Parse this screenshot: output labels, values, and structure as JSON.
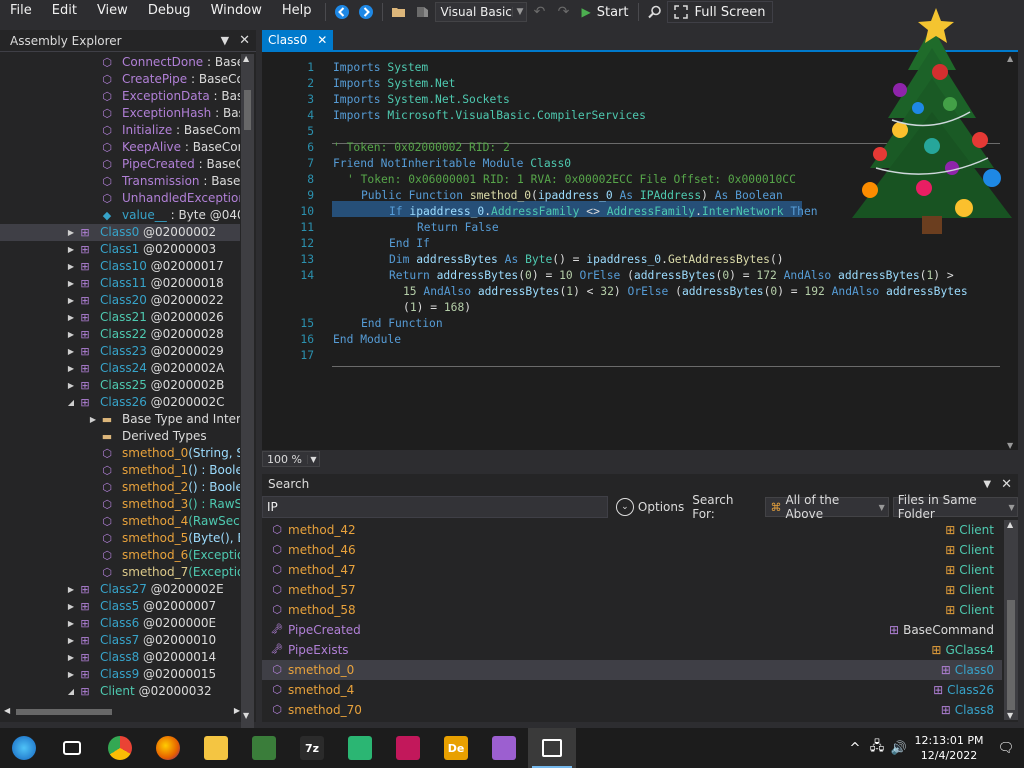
{
  "menu": [
    "File",
    "Edit",
    "View",
    "Debug",
    "Window",
    "Help"
  ],
  "toolbar": {
    "language": "Visual Basic",
    "start": "Start",
    "fullscreen": "Full Screen"
  },
  "explorer": {
    "title": "Assembly Explorer",
    "rows": [
      {
        "indent": 2,
        "expander": "",
        "icon": "method-icon",
        "name": "ConnectDone",
        "sig": " : BaseCo",
        "name_color": "purple",
        "sig_color": "gray"
      },
      {
        "indent": 2,
        "expander": "",
        "icon": "method-icon",
        "name": "CreatePipe",
        "sig": " : BaseCom",
        "name_color": "purple",
        "sig_color": "gray"
      },
      {
        "indent": 2,
        "expander": "",
        "icon": "method-icon",
        "name": "ExceptionData",
        "sig": " : BaseC",
        "name_color": "purple",
        "sig_color": "gray"
      },
      {
        "indent": 2,
        "expander": "",
        "icon": "method-icon",
        "name": "ExceptionHash",
        "sig": " : BaseC",
        "name_color": "purple",
        "sig_color": "gray"
      },
      {
        "indent": 2,
        "expander": "",
        "icon": "method-icon",
        "name": "Initialize",
        "sig": " : BaseComma",
        "name_color": "purple",
        "sig_color": "gray"
      },
      {
        "indent": 2,
        "expander": "",
        "icon": "method-icon",
        "name": "KeepAlive",
        "sig": " : BaseComr",
        "name_color": "purple",
        "sig_color": "gray"
      },
      {
        "indent": 2,
        "expander": "",
        "icon": "method-icon",
        "name": "PipeCreated",
        "sig": " : BaseCor",
        "name_color": "purple",
        "sig_color": "gray"
      },
      {
        "indent": 2,
        "expander": "",
        "icon": "method-icon",
        "name": "Transmission",
        "sig": " : BaseCo",
        "name_color": "purple",
        "sig_color": "gray"
      },
      {
        "indent": 2,
        "expander": "",
        "icon": "method-icon",
        "name": "UnhandledException",
        "sig": " :",
        "name_color": "purple",
        "sig_color": "gray"
      },
      {
        "indent": 2,
        "expander": "",
        "icon": "field-icon",
        "name": "value__",
        "sig": " : Byte @04000",
        "name_color": "cyan",
        "sig_color": "gray"
      },
      {
        "indent": 1,
        "expander": "▶",
        "icon": "class-icon",
        "name": "Class0",
        "sig": " @02000002",
        "name_color": "cyan",
        "sig_color": "gray",
        "selected": true
      },
      {
        "indent": 1,
        "expander": "▶",
        "icon": "class-icon",
        "name": "Class1",
        "sig": " @02000003",
        "name_color": "cyan",
        "sig_color": "gray"
      },
      {
        "indent": 1,
        "expander": "▶",
        "icon": "class-icon",
        "name": "Class10",
        "sig": " @02000017",
        "name_color": "cyan",
        "sig_color": "gray"
      },
      {
        "indent": 1,
        "expander": "▶",
        "icon": "class-icon",
        "name": "Class11",
        "sig": " @02000018",
        "name_color": "cyan",
        "sig_color": "gray"
      },
      {
        "indent": 1,
        "expander": "▶",
        "icon": "class-icon",
        "name": "Class20",
        "sig": " @02000022",
        "name_color": "cyan",
        "sig_color": "gray"
      },
      {
        "indent": 1,
        "expander": "▶",
        "icon": "class-icon",
        "name": "Class21",
        "sig": " @02000026",
        "name_color": "teal",
        "sig_color": "gray"
      },
      {
        "indent": 1,
        "expander": "▶",
        "icon": "class-icon",
        "name": "Class22",
        "sig": " @02000028",
        "name_color": "teal",
        "sig_color": "gray"
      },
      {
        "indent": 1,
        "expander": "▶",
        "icon": "class-icon",
        "name": "Class23",
        "sig": " @02000029",
        "name_color": "cyan",
        "sig_color": "gray"
      },
      {
        "indent": 1,
        "expander": "▶",
        "icon": "class-icon",
        "name": "Class24",
        "sig": " @0200002A",
        "name_color": "cyan",
        "sig_color": "gray"
      },
      {
        "indent": 1,
        "expander": "▶",
        "icon": "class-icon",
        "name": "Class25",
        "sig": " @0200002B",
        "name_color": "teal",
        "sig_color": "gray"
      },
      {
        "indent": 1,
        "expander": "◢",
        "icon": "class-icon",
        "name": "Class26",
        "sig": " @0200002C",
        "name_color": "cyan",
        "sig_color": "gray"
      },
      {
        "indent": 2,
        "expander": "▶",
        "icon": "folder-icon",
        "name": "Base Type and Interfac",
        "sig": "",
        "name_color": "gray",
        "sig_color": "gray"
      },
      {
        "indent": 2,
        "expander": "",
        "icon": "folder-icon",
        "name": "Derived Types",
        "sig": "",
        "name_color": "gray",
        "sig_color": "gray"
      },
      {
        "indent": 2,
        "expander": "",
        "icon": "method-icon",
        "name": "smethod_0",
        "sig": "(String, Stri",
        "name_color": "orange",
        "sig_color": "blue"
      },
      {
        "indent": 2,
        "expander": "",
        "icon": "method-icon",
        "name": "smethod_1",
        "sig": "() : Boolear",
        "name_color": "orange",
        "sig_color": "blue"
      },
      {
        "indent": 2,
        "expander": "",
        "icon": "method-icon",
        "name": "smethod_2",
        "sig": "() : Boolear",
        "name_color": "orange",
        "sig_color": "blue"
      },
      {
        "indent": 2,
        "expander": "",
        "icon": "method-icon",
        "name": "smethod_3",
        "sig": "() : RawSec",
        "name_color": "orange",
        "sig_color": "teal"
      },
      {
        "indent": 2,
        "expander": "",
        "icon": "method-icon",
        "name": "smethod_4",
        "sig": "(RawSecuri",
        "name_color": "orange",
        "sig_color": "teal"
      },
      {
        "indent": 2,
        "expander": "",
        "icon": "method-icon",
        "name": "smethod_5",
        "sig": "(Byte(), Byt",
        "name_color": "orange",
        "sig_color": "blue"
      },
      {
        "indent": 2,
        "expander": "",
        "icon": "method-icon",
        "name": "smethod_6",
        "sig": "(Exception)",
        "name_color": "orange",
        "sig_color": "teal"
      },
      {
        "indent": 2,
        "expander": "",
        "icon": "method-icon",
        "name": "smethod_7",
        "sig": "(Exception)",
        "name_color": "yellow",
        "sig_color": "teal"
      },
      {
        "indent": 1,
        "expander": "▶",
        "icon": "class-icon",
        "name": "Class27",
        "sig": " @0200002E",
        "name_color": "cyan",
        "sig_color": "gray"
      },
      {
        "indent": 1,
        "expander": "▶",
        "icon": "class-icon",
        "name": "Class5",
        "sig": " @02000007",
        "name_color": "cyan",
        "sig_color": "gray"
      },
      {
        "indent": 1,
        "expander": "▶",
        "icon": "class-icon",
        "name": "Class6",
        "sig": " @0200000E",
        "name_color": "cyan",
        "sig_color": "gray"
      },
      {
        "indent": 1,
        "expander": "▶",
        "icon": "class-icon",
        "name": "Class7",
        "sig": " @02000010",
        "name_color": "cyan",
        "sig_color": "gray"
      },
      {
        "indent": 1,
        "expander": "▶",
        "icon": "class-icon",
        "name": "Class8",
        "sig": " @02000014",
        "name_color": "cyan",
        "sig_color": "gray"
      },
      {
        "indent": 1,
        "expander": "▶",
        "icon": "class-icon",
        "name": "Class9",
        "sig": " @02000015",
        "name_color": "cyan",
        "sig_color": "gray"
      },
      {
        "indent": 1,
        "expander": "◢",
        "icon": "class-icon",
        "name": "Client",
        "sig": " @02000032",
        "name_color": "teal",
        "sig_color": "gray"
      }
    ]
  },
  "editor": {
    "tab": "Class0",
    "zoom": "100 %",
    "lines": [
      {
        "n": "1",
        "indent": 0,
        "tokens": [
          [
            "k",
            "Imports "
          ],
          [
            "t",
            "System"
          ]
        ]
      },
      {
        "n": "2",
        "indent": 0,
        "tokens": [
          [
            "k",
            "Imports "
          ],
          [
            "t",
            "System.Net"
          ]
        ]
      },
      {
        "n": "3",
        "indent": 0,
        "tokens": [
          [
            "k",
            "Imports "
          ],
          [
            "t",
            "System.Net.Sockets"
          ]
        ]
      },
      {
        "n": "4",
        "indent": 0,
        "tokens": [
          [
            "k",
            "Imports "
          ],
          [
            "t",
            "Microsoft.VisualBasic.CompilerServices"
          ]
        ]
      },
      {
        "n": "5",
        "indent": 0,
        "tokens": []
      },
      {
        "n": "6",
        "indent": 0,
        "tokens": [
          [
            "cm",
            "' Token: 0x02000002 RID: 2"
          ]
        ]
      },
      {
        "n": "7",
        "indent": 0,
        "tokens": [
          [
            "k",
            "Friend NotInheritable Module "
          ],
          [
            "t",
            "Class0"
          ]
        ]
      },
      {
        "n": "8",
        "indent": 2,
        "tokens": [
          [
            "cm",
            "' Token: 0x06000001 RID: 1 RVA: 0x00002ECC File Offset: 0x000010CC"
          ]
        ]
      },
      {
        "n": "9",
        "indent": 4,
        "tokens": [
          [
            "k",
            "Public Function "
          ],
          [
            "m",
            "smethod_0"
          ],
          [
            "w",
            "("
          ],
          [
            "v",
            "ipaddress_0"
          ],
          [
            "k",
            " As "
          ],
          [
            "t",
            "IPAddress"
          ],
          [
            "w",
            ") "
          ],
          [
            "k",
            "As Boolean"
          ]
        ]
      },
      {
        "n": "10",
        "indent": 8,
        "tokens": [
          [
            "k",
            "If "
          ],
          [
            "v",
            "ipaddress_0"
          ],
          [
            "w",
            "."
          ],
          [
            "t",
            "AddressFamily"
          ],
          [
            "w",
            " <> "
          ],
          [
            "t",
            "AddressFamily"
          ],
          [
            "w",
            "."
          ],
          [
            "t",
            "InterNetwork"
          ],
          [
            "k",
            " Then"
          ]
        ]
      },
      {
        "n": "11",
        "indent": 12,
        "tokens": [
          [
            "k",
            "Return False"
          ]
        ]
      },
      {
        "n": "12",
        "indent": 8,
        "tokens": [
          [
            "k",
            "End If"
          ]
        ]
      },
      {
        "n": "13",
        "indent": 8,
        "tokens": [
          [
            "k",
            "Dim "
          ],
          [
            "v",
            "addressBytes"
          ],
          [
            "k",
            " As "
          ],
          [
            "t",
            "Byte"
          ],
          [
            "w",
            "() = "
          ],
          [
            "v",
            "ipaddress_0"
          ],
          [
            "w",
            "."
          ],
          [
            "m",
            "GetAddressBytes"
          ],
          [
            "w",
            "()"
          ]
        ]
      },
      {
        "n": "14",
        "indent": 8,
        "tokens": [
          [
            "k",
            "Return "
          ],
          [
            "v",
            "addressBytes"
          ],
          [
            "w",
            "("
          ],
          [
            "n",
            "0"
          ],
          [
            "w",
            ") = "
          ],
          [
            "n",
            "10"
          ],
          [
            "k",
            " OrElse "
          ],
          [
            "w",
            "("
          ],
          [
            "v",
            "addressBytes"
          ],
          [
            "w",
            "("
          ],
          [
            "n",
            "0"
          ],
          [
            "w",
            ") = "
          ],
          [
            "n",
            "172"
          ],
          [
            "k",
            " AndAlso "
          ],
          [
            "v",
            "addressBytes"
          ],
          [
            "w",
            "("
          ],
          [
            "n",
            "1"
          ],
          [
            "w",
            ") >"
          ]
        ]
      },
      {
        "n": "",
        "indent": 10,
        "tokens": [
          [
            "n",
            "15"
          ],
          [
            "k",
            " AndAlso "
          ],
          [
            "v",
            "addressBytes"
          ],
          [
            "w",
            "("
          ],
          [
            "n",
            "1"
          ],
          [
            "w",
            ") < "
          ],
          [
            "n",
            "32"
          ],
          [
            "w",
            ") "
          ],
          [
            "k",
            "OrElse "
          ],
          [
            "w",
            "("
          ],
          [
            "v",
            "addressBytes"
          ],
          [
            "w",
            "("
          ],
          [
            "n",
            "0"
          ],
          [
            "w",
            ") = "
          ],
          [
            "n",
            "192"
          ],
          [
            "k",
            " AndAlso "
          ],
          [
            "v",
            "addressBytes"
          ]
        ]
      },
      {
        "n": "",
        "indent": 10,
        "tokens": [
          [
            "w",
            "("
          ],
          [
            "n",
            "1"
          ],
          [
            "w",
            ") = "
          ],
          [
            "n",
            "168"
          ],
          [
            "w",
            ")"
          ]
        ]
      },
      {
        "n": "15",
        "indent": 4,
        "tokens": [
          [
            "k",
            "End Function"
          ]
        ]
      },
      {
        "n": "16",
        "indent": 0,
        "tokens": [
          [
            "k",
            "End Module"
          ]
        ]
      },
      {
        "n": "17",
        "indent": 0,
        "tokens": []
      }
    ]
  },
  "search": {
    "title": "Search",
    "query": "IP",
    "options_label": "Options",
    "search_for_label": "Search For:",
    "search_for_value": "All of the Above",
    "scope_value": "Files in Same Folder",
    "results": [
      {
        "icon": "method-icon",
        "name": "method_42",
        "name_color": "orange",
        "loc_icon": "class-icon",
        "loc": "Client",
        "loc_color": "teal"
      },
      {
        "icon": "method-icon",
        "name": "method_46",
        "name_color": "orange",
        "loc_icon": "class-icon",
        "loc": "Client",
        "loc_color": "teal"
      },
      {
        "icon": "method-icon",
        "name": "method_47",
        "name_color": "orange",
        "loc_icon": "class-icon",
        "loc": "Client",
        "loc_color": "teal"
      },
      {
        "icon": "method-icon",
        "name": "method_57",
        "name_color": "orange",
        "loc_icon": "class-icon",
        "loc": "Client",
        "loc_color": "teal"
      },
      {
        "icon": "method-icon",
        "name": "method_58",
        "name_color": "orange",
        "loc_icon": "class-icon",
        "loc": "Client",
        "loc_color": "teal"
      },
      {
        "icon": "property-icon",
        "name": "PipeCreated",
        "name_color": "purple",
        "loc_icon": "class-icon",
        "loc": "BaseCommand",
        "loc_color": "gray"
      },
      {
        "icon": "property-icon",
        "name": "PipeExists",
        "name_color": "purple",
        "loc_icon": "class-icon",
        "loc": "GClass4",
        "loc_color": "teal"
      },
      {
        "icon": "method-icon",
        "name": "smethod_0",
        "name_color": "orange",
        "loc_icon": "class-icon",
        "loc": "Class0",
        "loc_color": "cyan",
        "selected": true
      },
      {
        "icon": "method-icon",
        "name": "smethod_4",
        "name_color": "orange",
        "loc_icon": "class-icon",
        "loc": "Class26",
        "loc_color": "cyan"
      },
      {
        "icon": "method-icon",
        "name": "smethod_70",
        "name_color": "orange",
        "loc_icon": "class-icon",
        "loc": "Class8",
        "loc_color": "cyan"
      }
    ]
  },
  "taskbar": {
    "apps": [
      {
        "name": "start-button",
        "glyph": "",
        "bg": "#1e88e5"
      },
      {
        "name": "task-view",
        "glyph": "",
        "bg": ""
      },
      {
        "name": "chrome",
        "glyph": "",
        "bg": "#34a853"
      },
      {
        "name": "firefox",
        "glyph": "",
        "bg": "#e66000"
      },
      {
        "name": "file-explorer",
        "glyph": "",
        "bg": "#f4c542"
      },
      {
        "name": "app-xd",
        "glyph": "",
        "bg": "#3a7d3a"
      },
      {
        "name": "7zip",
        "glyph": "7z",
        "bg": "#2b2b2b"
      },
      {
        "name": "app-green",
        "glyph": "",
        "bg": "#2bb673"
      },
      {
        "name": "app-red",
        "glyph": "",
        "bg": "#c2185b"
      },
      {
        "name": "app-de",
        "glyph": "De",
        "bg": "#e8a000"
      },
      {
        "name": "app-ef",
        "glyph": "",
        "bg": "#9c5fd0"
      },
      {
        "name": "app-windows",
        "glyph": "",
        "bg": "",
        "active": true
      }
    ],
    "time": "12:13:01 PM",
    "date": "12/4/2022"
  },
  "colors": {
    "accent": "#007acc",
    "orange": "#e8a23c",
    "purple": "#b180d7",
    "teal": "#4ec9b0",
    "cyan": "#37a3c9"
  }
}
